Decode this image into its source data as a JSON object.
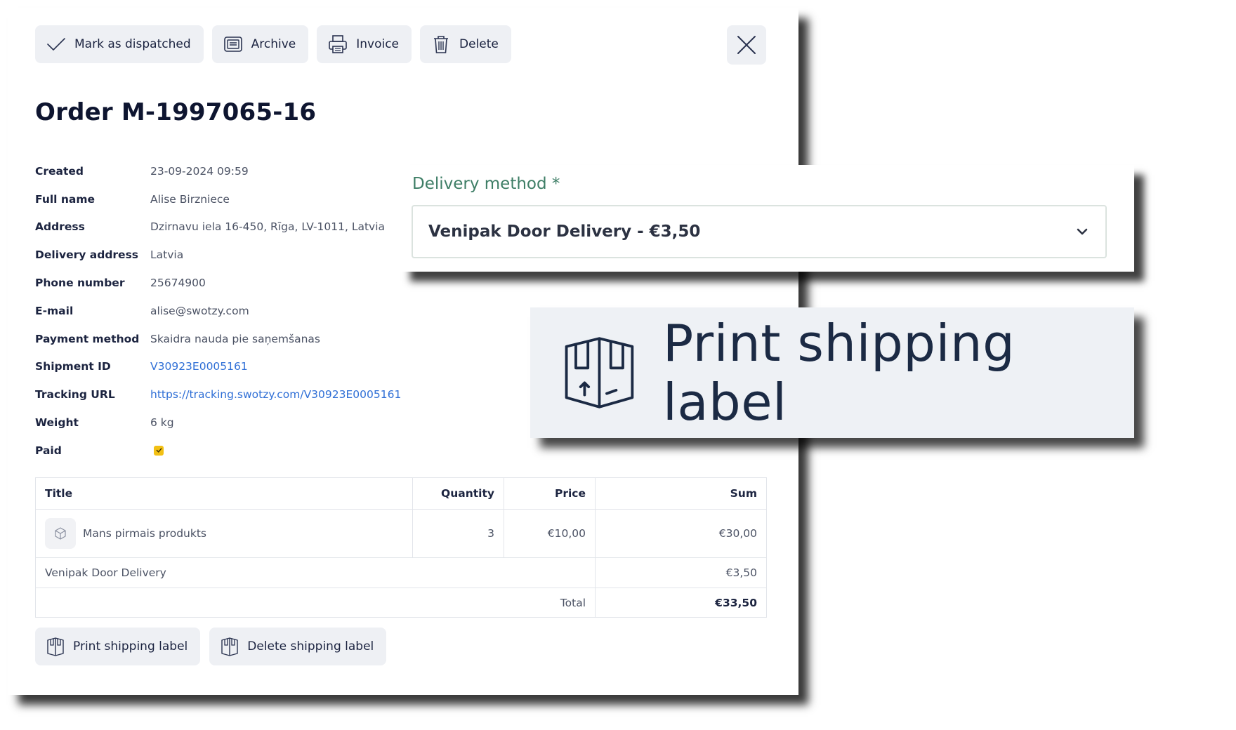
{
  "toolbar": {
    "mark_dispatched": "Mark as dispatched",
    "archive": "Archive",
    "invoice": "Invoice",
    "delete": "Delete"
  },
  "order": {
    "title": "Order M-1997065-16",
    "details": [
      {
        "label": "Created",
        "value": "23-09-2024 09:59"
      },
      {
        "label": "Full name",
        "value": "Alise Birzniece"
      },
      {
        "label": "Address",
        "value": "Dzirnavu iela 16-450, Rīga, LV-1011, Latvia"
      },
      {
        "label": "Delivery address",
        "value": "Latvia"
      },
      {
        "label": "Phone number",
        "value": "25674900"
      },
      {
        "label": "E-mail",
        "value": "alise@swotzy.com"
      },
      {
        "label": "Payment method",
        "value": "Skaidra nauda pie saņemšanas"
      },
      {
        "label": "Shipment ID",
        "value": "V30923E0005161"
      },
      {
        "label": "Tracking URL",
        "value": "https://tracking.swotzy.com/V30923E0005161"
      },
      {
        "label": "Weight",
        "value": "6 kg"
      },
      {
        "label": "Paid",
        "checked": true
      }
    ]
  },
  "items_table": {
    "headers": {
      "title": "Title",
      "quantity": "Quantity",
      "price": "Price",
      "sum": "Sum"
    },
    "rows": [
      {
        "title": "Mans pirmais produkts",
        "quantity": "3",
        "price": "€10,00",
        "sum": "€30,00"
      }
    ],
    "delivery": {
      "label": "Venipak Door Delivery",
      "sum": "€3,50"
    },
    "total": {
      "label": "Total",
      "sum": "€33,50"
    }
  },
  "bottom_actions": {
    "print_label": "Print shipping label",
    "delete_label": "Delete shipping label"
  },
  "delivery_panel": {
    "label": "Delivery method *",
    "selected": "Venipak Door Delivery - €3,50"
  },
  "print_big": {
    "label": "Print shipping label"
  },
  "colors": {
    "button_bg": "#eef0f4",
    "link": "#2f6fd6",
    "paid_check": "#f2c014",
    "delivery_label": "#3e7e66"
  }
}
